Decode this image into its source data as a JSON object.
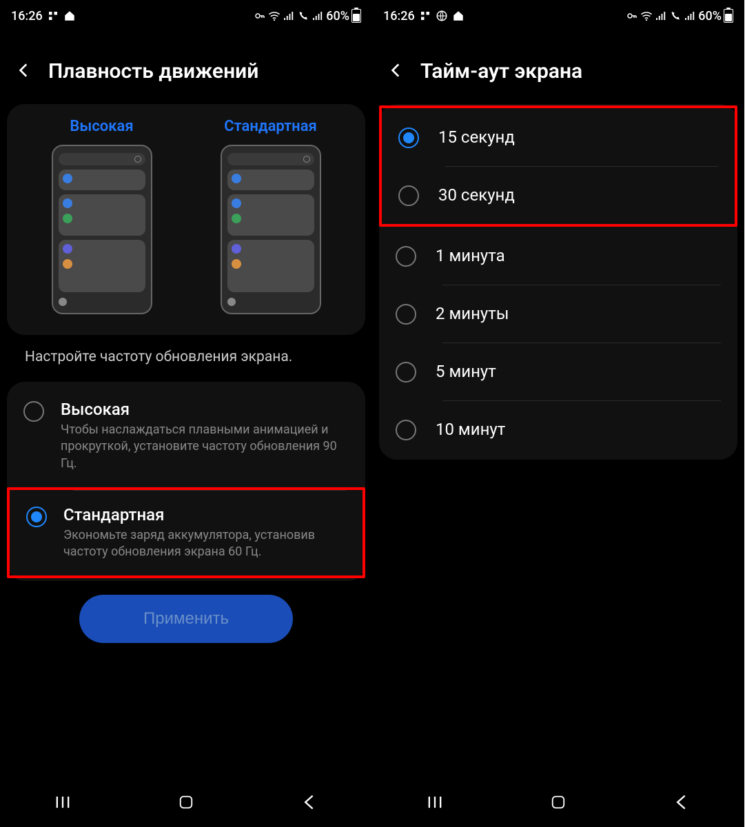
{
  "status": {
    "time": "16:26",
    "battery": "60%"
  },
  "left": {
    "title": "Плавность движений",
    "preview": {
      "high": "Высокая",
      "standard": "Стандартная"
    },
    "hint": "Настройте частоту обновления экрана.",
    "options": [
      {
        "title": "Высокая",
        "desc": "Чтобы наслаждаться плавными анимацией и прокруткой, установите частоту обновления 90 Гц.",
        "selected": false,
        "highlighted": false
      },
      {
        "title": "Стандартная",
        "desc": "Экономьте заряд аккумулятора, установив частоту обновления экрана 60 Гц.",
        "selected": true,
        "highlighted": true
      }
    ],
    "apply": "Применить"
  },
  "right": {
    "title": "Тайм-аут экрана",
    "options": [
      {
        "label": "15 секунд",
        "selected": true
      },
      {
        "label": "30 секунд",
        "selected": false
      },
      {
        "label": "1 минута",
        "selected": false
      },
      {
        "label": "2 минуты",
        "selected": false
      },
      {
        "label": "5 минут",
        "selected": false
      },
      {
        "label": "10 минут",
        "selected": false
      }
    ],
    "highlight_first_n": 2
  }
}
